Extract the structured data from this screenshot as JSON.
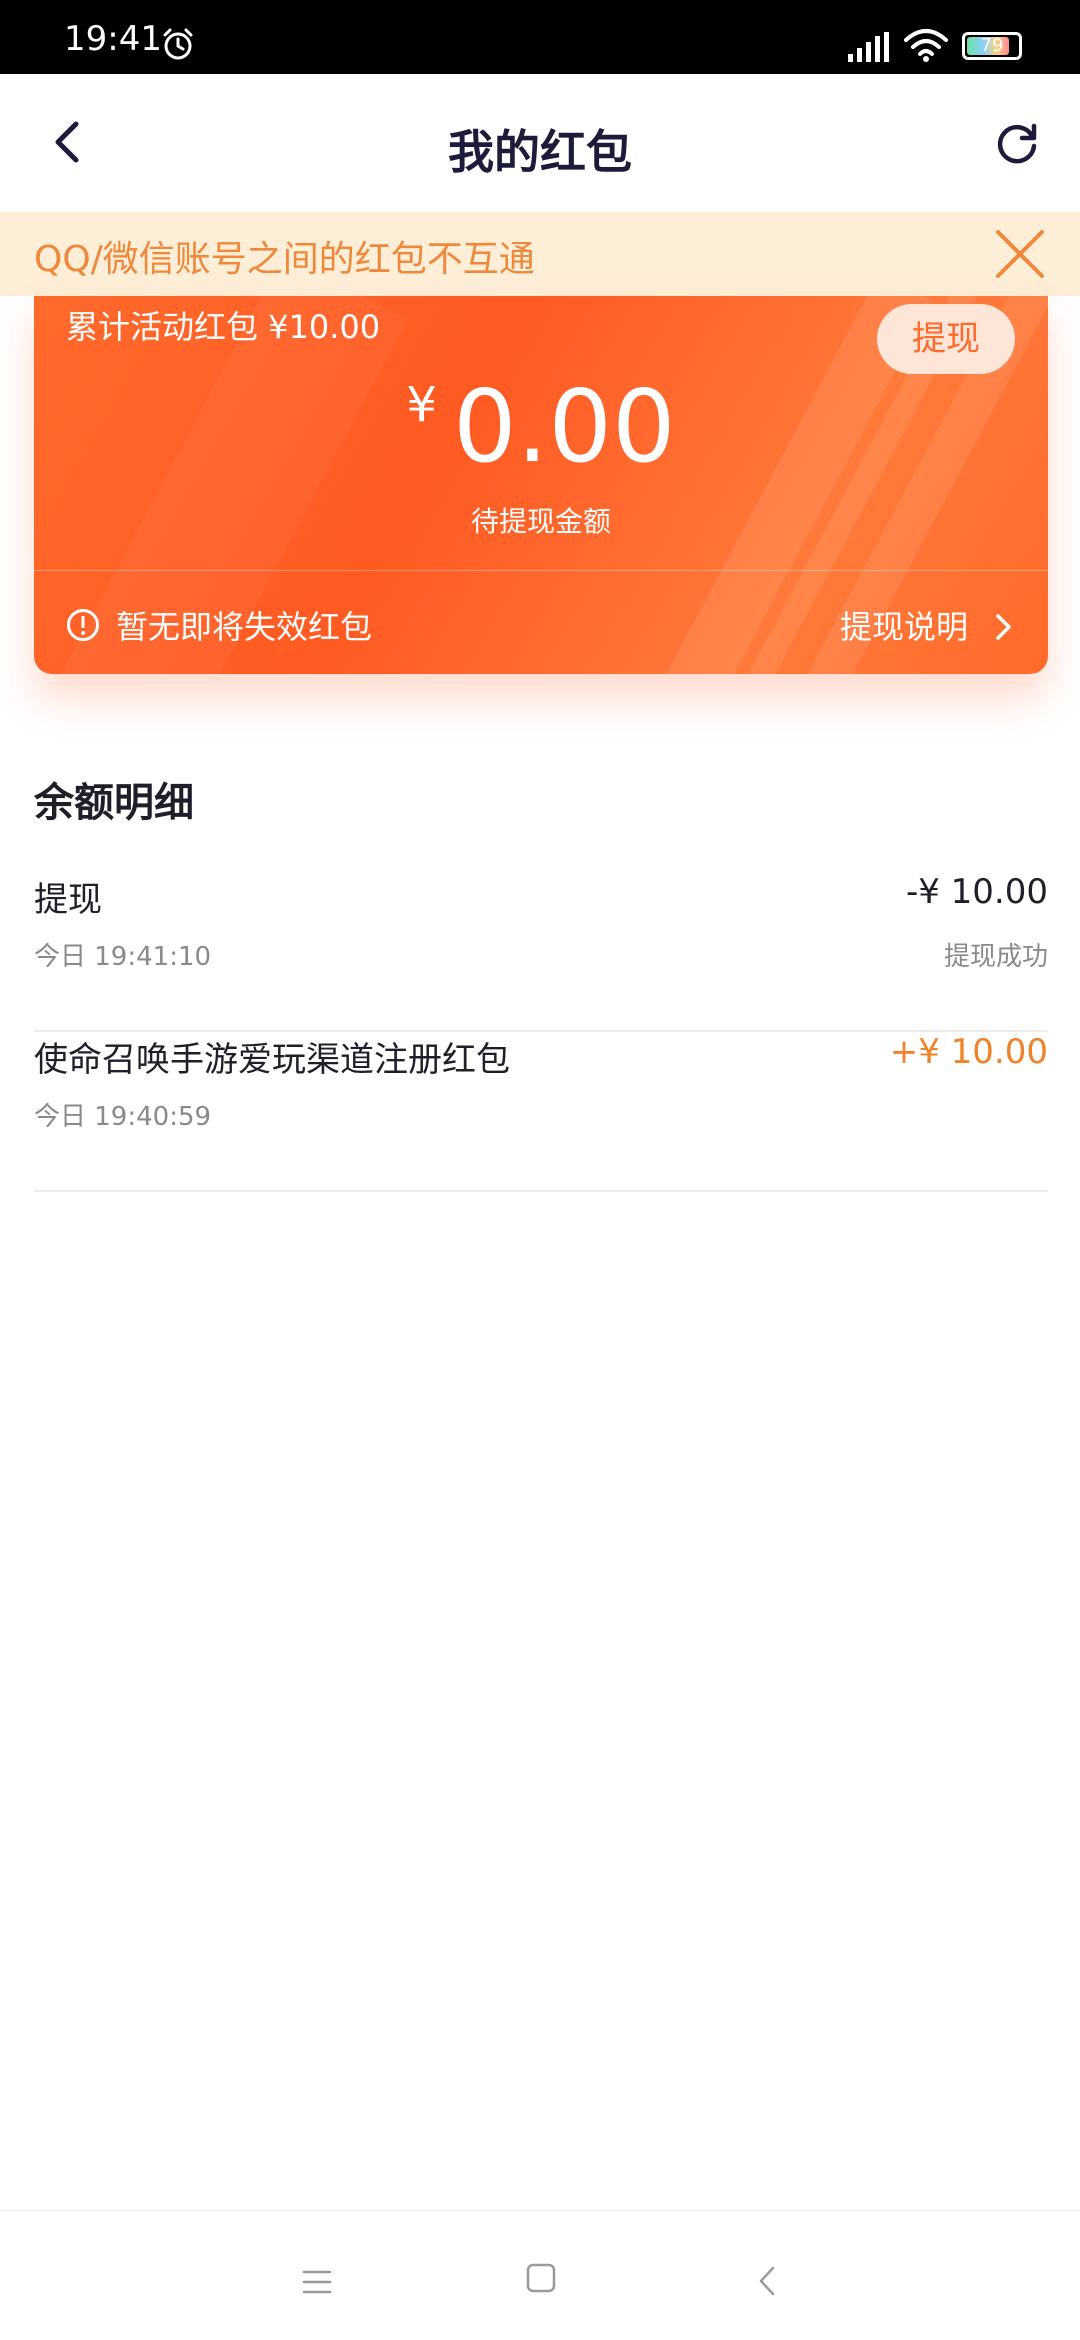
{
  "status_bar": {
    "time": "19:41",
    "battery": "79"
  },
  "header": {
    "title": "我的红包"
  },
  "notice": {
    "text": "QQ/微信账号之间的红包不互通"
  },
  "wallet_card": {
    "cumulative_label": "累计活动红包 ¥10.00",
    "withdraw_button": "提现",
    "currency_symbol": "¥",
    "pending_amount": "0.00",
    "pending_label": "待提现金额",
    "expiring_notice": "暂无即将失效红包",
    "withdraw_explain": "提现说明"
  },
  "balance_details": {
    "title": "余额明细",
    "rows": [
      {
        "name": "提现",
        "time": "今日 19:41:10",
        "amount": "-¥ 10.00",
        "status": "提现成功"
      },
      {
        "name": "使命召唤手游爱玩渠道注册红包",
        "time": "今日 19:40:59",
        "amount": "+¥ 10.00",
        "status": ""
      }
    ]
  },
  "colors": {
    "accent_orange": "#ff6a2a",
    "notice_text": "#f0883a",
    "positive_amount": "#f0822a"
  },
  "icons": [
    "alarm-icon",
    "signal-icon",
    "wifi-icon",
    "battery-icon",
    "back-arrow-icon",
    "refresh-icon",
    "close-icon",
    "warning-icon",
    "chevron-right-icon",
    "menu-icon",
    "home-icon",
    "system-back-icon"
  ]
}
